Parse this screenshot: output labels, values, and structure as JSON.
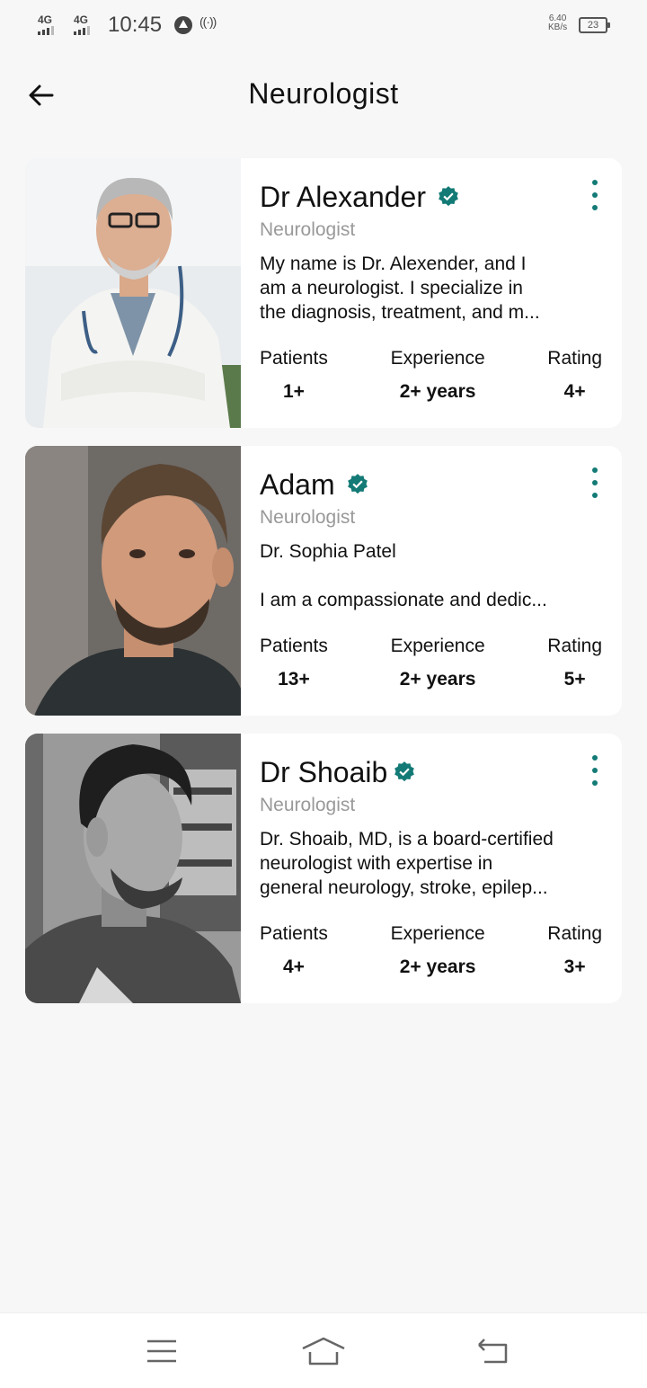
{
  "status_bar": {
    "signal1": "4G",
    "signal2": "4G",
    "time": "10:45",
    "hotspot": "((·))",
    "speed_value": "6.40",
    "speed_unit": "KB/s",
    "battery": "23"
  },
  "header": {
    "title": "Neurologist",
    "back_icon": "arrow-left-icon"
  },
  "labels": {
    "patients": "Patients",
    "experience": "Experience",
    "rating": "Rating"
  },
  "doctors": [
    {
      "name": "Dr Alexander",
      "specialty": "Neurologist",
      "bio_lines": [
        "My name is Dr. Alexender, and I",
        "am a neurologist. I specialize in",
        "the diagnosis, treatment, and m..."
      ],
      "patients": "1+",
      "experience": "2+ years",
      "rating": "4+"
    },
    {
      "name": "Adam",
      "specialty": "Neurologist",
      "bio_lines": [
        "Dr. Sophia Patel",
        "",
        "I am a compassionate and dedic..."
      ],
      "patients": "13+",
      "experience": "2+ years",
      "rating": "5+"
    },
    {
      "name": "Dr Shoaib",
      "specialty": "Neurologist",
      "bio_lines": [
        "Dr. Shoaib, MD, is a board-certified",
        "neurologist with expertise in",
        "general neurology, stroke, epilep..."
      ],
      "patients": "4+",
      "experience": "2+ years",
      "rating": "3+"
    }
  ],
  "colors": {
    "accent": "#137a76",
    "muted_text": "#999999",
    "background": "#f7f7f7",
    "card": "#ffffff"
  },
  "nav": {
    "icons": [
      "menu-icon",
      "home-icon",
      "back-icon"
    ]
  }
}
